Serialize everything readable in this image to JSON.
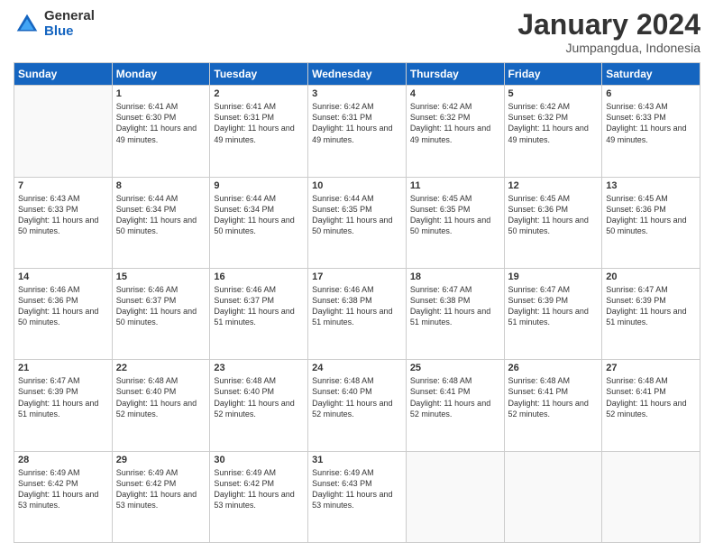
{
  "header": {
    "logo": {
      "general": "General",
      "blue": "Blue"
    },
    "title": "January 2024",
    "location": "Jumpangdua, Indonesia"
  },
  "calendar": {
    "weekdays": [
      "Sunday",
      "Monday",
      "Tuesday",
      "Wednesday",
      "Thursday",
      "Friday",
      "Saturday"
    ],
    "weeks": [
      [
        {
          "day": "",
          "sunrise": "",
          "sunset": "",
          "daylight": ""
        },
        {
          "day": "1",
          "sunrise": "Sunrise: 6:41 AM",
          "sunset": "Sunset: 6:30 PM",
          "daylight": "Daylight: 11 hours and 49 minutes."
        },
        {
          "day": "2",
          "sunrise": "Sunrise: 6:41 AM",
          "sunset": "Sunset: 6:31 PM",
          "daylight": "Daylight: 11 hours and 49 minutes."
        },
        {
          "day": "3",
          "sunrise": "Sunrise: 6:42 AM",
          "sunset": "Sunset: 6:31 PM",
          "daylight": "Daylight: 11 hours and 49 minutes."
        },
        {
          "day": "4",
          "sunrise": "Sunrise: 6:42 AM",
          "sunset": "Sunset: 6:32 PM",
          "daylight": "Daylight: 11 hours and 49 minutes."
        },
        {
          "day": "5",
          "sunrise": "Sunrise: 6:42 AM",
          "sunset": "Sunset: 6:32 PM",
          "daylight": "Daylight: 11 hours and 49 minutes."
        },
        {
          "day": "6",
          "sunrise": "Sunrise: 6:43 AM",
          "sunset": "Sunset: 6:33 PM",
          "daylight": "Daylight: 11 hours and 49 minutes."
        }
      ],
      [
        {
          "day": "7",
          "sunrise": "Sunrise: 6:43 AM",
          "sunset": "Sunset: 6:33 PM",
          "daylight": "Daylight: 11 hours and 50 minutes."
        },
        {
          "day": "8",
          "sunrise": "Sunrise: 6:44 AM",
          "sunset": "Sunset: 6:34 PM",
          "daylight": "Daylight: 11 hours and 50 minutes."
        },
        {
          "day": "9",
          "sunrise": "Sunrise: 6:44 AM",
          "sunset": "Sunset: 6:34 PM",
          "daylight": "Daylight: 11 hours and 50 minutes."
        },
        {
          "day": "10",
          "sunrise": "Sunrise: 6:44 AM",
          "sunset": "Sunset: 6:35 PM",
          "daylight": "Daylight: 11 hours and 50 minutes."
        },
        {
          "day": "11",
          "sunrise": "Sunrise: 6:45 AM",
          "sunset": "Sunset: 6:35 PM",
          "daylight": "Daylight: 11 hours and 50 minutes."
        },
        {
          "day": "12",
          "sunrise": "Sunrise: 6:45 AM",
          "sunset": "Sunset: 6:36 PM",
          "daylight": "Daylight: 11 hours and 50 minutes."
        },
        {
          "day": "13",
          "sunrise": "Sunrise: 6:45 AM",
          "sunset": "Sunset: 6:36 PM",
          "daylight": "Daylight: 11 hours and 50 minutes."
        }
      ],
      [
        {
          "day": "14",
          "sunrise": "Sunrise: 6:46 AM",
          "sunset": "Sunset: 6:36 PM",
          "daylight": "Daylight: 11 hours and 50 minutes."
        },
        {
          "day": "15",
          "sunrise": "Sunrise: 6:46 AM",
          "sunset": "Sunset: 6:37 PM",
          "daylight": "Daylight: 11 hours and 50 minutes."
        },
        {
          "day": "16",
          "sunrise": "Sunrise: 6:46 AM",
          "sunset": "Sunset: 6:37 PM",
          "daylight": "Daylight: 11 hours and 51 minutes."
        },
        {
          "day": "17",
          "sunrise": "Sunrise: 6:46 AM",
          "sunset": "Sunset: 6:38 PM",
          "daylight": "Daylight: 11 hours and 51 minutes."
        },
        {
          "day": "18",
          "sunrise": "Sunrise: 6:47 AM",
          "sunset": "Sunset: 6:38 PM",
          "daylight": "Daylight: 11 hours and 51 minutes."
        },
        {
          "day": "19",
          "sunrise": "Sunrise: 6:47 AM",
          "sunset": "Sunset: 6:39 PM",
          "daylight": "Daylight: 11 hours and 51 minutes."
        },
        {
          "day": "20",
          "sunrise": "Sunrise: 6:47 AM",
          "sunset": "Sunset: 6:39 PM",
          "daylight": "Daylight: 11 hours and 51 minutes."
        }
      ],
      [
        {
          "day": "21",
          "sunrise": "Sunrise: 6:47 AM",
          "sunset": "Sunset: 6:39 PM",
          "daylight": "Daylight: 11 hours and 51 minutes."
        },
        {
          "day": "22",
          "sunrise": "Sunrise: 6:48 AM",
          "sunset": "Sunset: 6:40 PM",
          "daylight": "Daylight: 11 hours and 52 minutes."
        },
        {
          "day": "23",
          "sunrise": "Sunrise: 6:48 AM",
          "sunset": "Sunset: 6:40 PM",
          "daylight": "Daylight: 11 hours and 52 minutes."
        },
        {
          "day": "24",
          "sunrise": "Sunrise: 6:48 AM",
          "sunset": "Sunset: 6:40 PM",
          "daylight": "Daylight: 11 hours and 52 minutes."
        },
        {
          "day": "25",
          "sunrise": "Sunrise: 6:48 AM",
          "sunset": "Sunset: 6:41 PM",
          "daylight": "Daylight: 11 hours and 52 minutes."
        },
        {
          "day": "26",
          "sunrise": "Sunrise: 6:48 AM",
          "sunset": "Sunset: 6:41 PM",
          "daylight": "Daylight: 11 hours and 52 minutes."
        },
        {
          "day": "27",
          "sunrise": "Sunrise: 6:48 AM",
          "sunset": "Sunset: 6:41 PM",
          "daylight": "Daylight: 11 hours and 52 minutes."
        }
      ],
      [
        {
          "day": "28",
          "sunrise": "Sunrise: 6:49 AM",
          "sunset": "Sunset: 6:42 PM",
          "daylight": "Daylight: 11 hours and 53 minutes."
        },
        {
          "day": "29",
          "sunrise": "Sunrise: 6:49 AM",
          "sunset": "Sunset: 6:42 PM",
          "daylight": "Daylight: 11 hours and 53 minutes."
        },
        {
          "day": "30",
          "sunrise": "Sunrise: 6:49 AM",
          "sunset": "Sunset: 6:42 PM",
          "daylight": "Daylight: 11 hours and 53 minutes."
        },
        {
          "day": "31",
          "sunrise": "Sunrise: 6:49 AM",
          "sunset": "Sunset: 6:43 PM",
          "daylight": "Daylight: 11 hours and 53 minutes."
        },
        {
          "day": "",
          "sunrise": "",
          "sunset": "",
          "daylight": ""
        },
        {
          "day": "",
          "sunrise": "",
          "sunset": "",
          "daylight": ""
        },
        {
          "day": "",
          "sunrise": "",
          "sunset": "",
          "daylight": ""
        }
      ]
    ]
  }
}
